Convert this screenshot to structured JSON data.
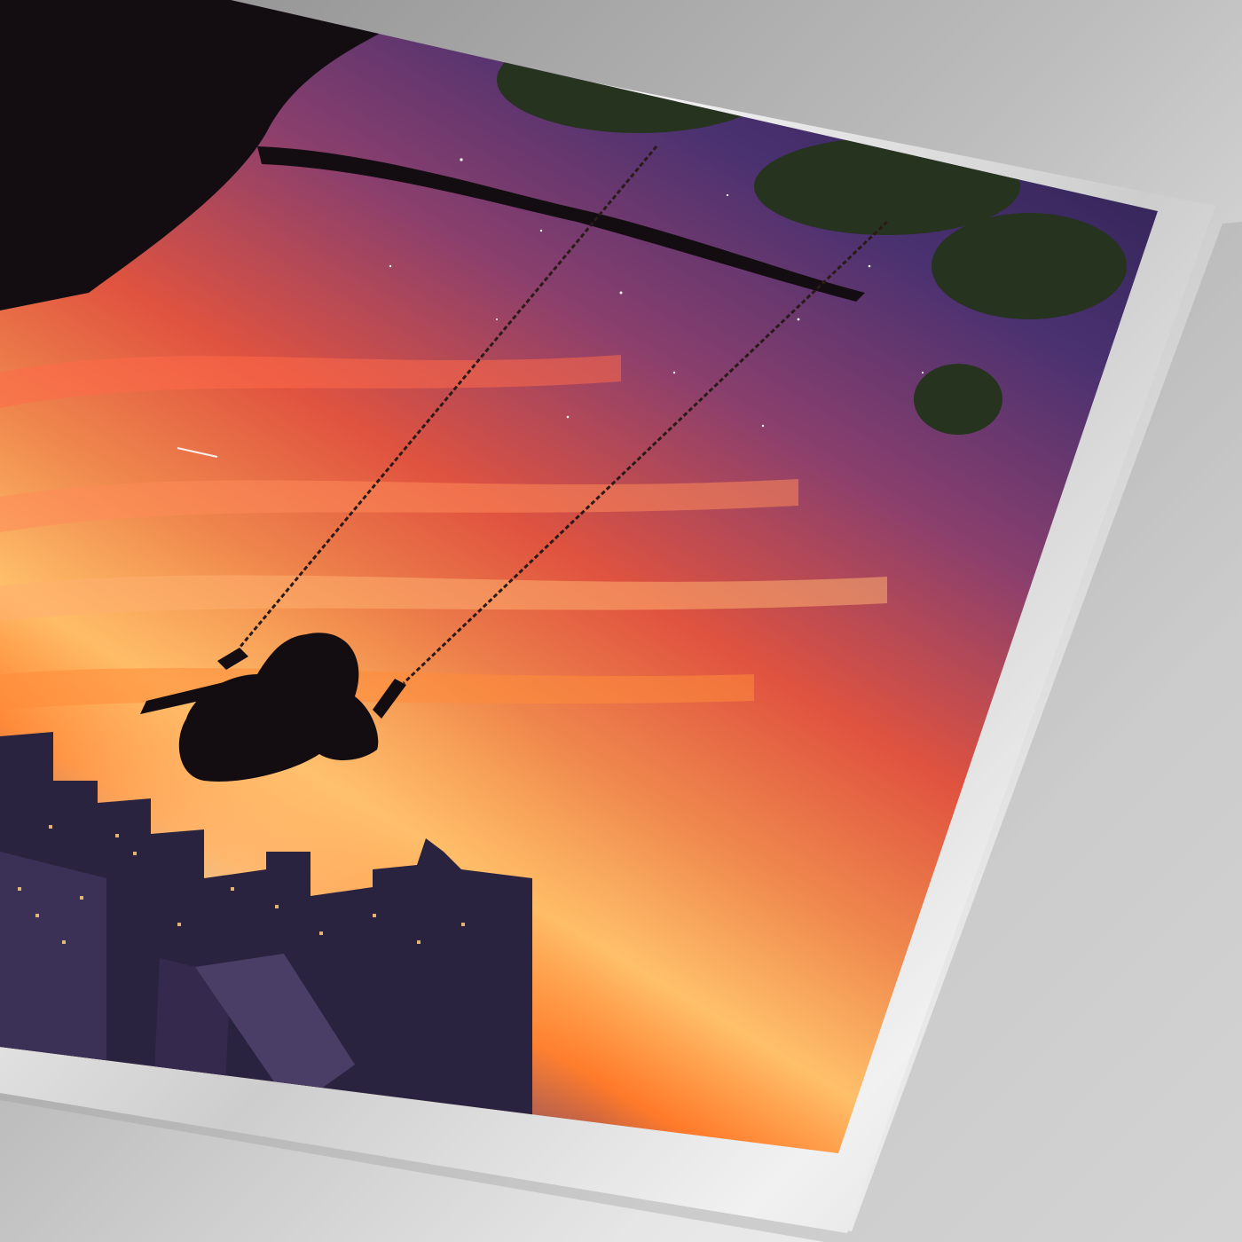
{
  "scene": {
    "subject": "metal-print-product-mockup",
    "background_colors": [
      "#8f8f8f",
      "#e2e2e2",
      "#f3f3f3"
    ],
    "print_border_colors": [
      "#b9b9b9",
      "#f4f4f4",
      "#cfcfcf",
      "#efefef"
    ],
    "sky_colors": [
      "#2b2150",
      "#4a3170",
      "#8a3f6d",
      "#e0533f",
      "#f08a4e",
      "#ffc06a",
      "#ff7a2a"
    ],
    "city_colors": [
      "#2a2340",
      "#3b3055",
      "#ffcf7a"
    ],
    "silhouette_color": "#130d12",
    "foliage_color": "#26331e"
  }
}
